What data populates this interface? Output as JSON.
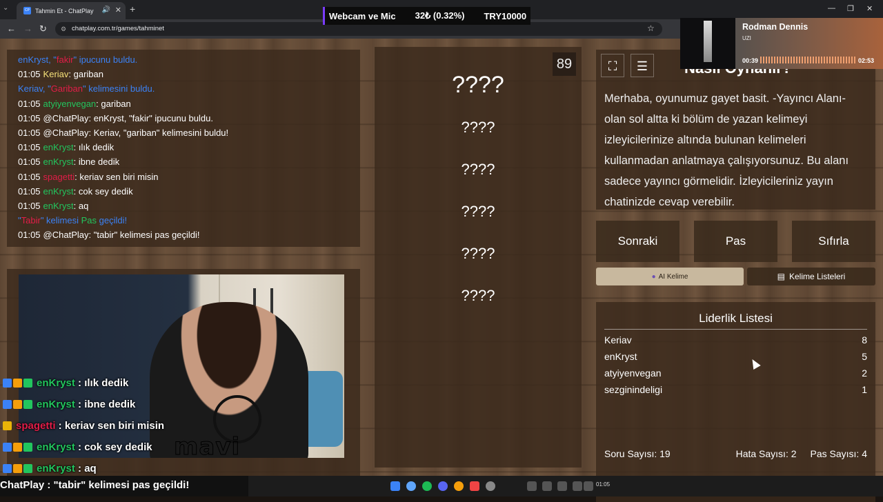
{
  "browser": {
    "tab_title": "Tahmin Et - ChatPlay",
    "tab_favicon": "CP",
    "url": "chatplay.com.tr/games/tahminet"
  },
  "stream_header": {
    "source": "Webcam ve Mic",
    "price": "32₺ (0.32%)",
    "goal": "TRY10000"
  },
  "media_widget": {
    "title": "Rodman Dennis",
    "artist": "UZI",
    "elapsed": "00:39",
    "duration": "02:53"
  },
  "chat_log": [
    {
      "time": "",
      "parts": [
        {
          "t": "enKryst, \"",
          "c": "blue"
        },
        {
          "t": "fakir",
          "c": "red"
        },
        {
          "t": "\" ipucunu buldu.",
          "c": "blue"
        }
      ]
    },
    {
      "time": "01:05",
      "parts": [
        {
          "t": "Keriav",
          "c": "yellow"
        },
        {
          "t": ": gariban",
          "c": "white"
        }
      ]
    },
    {
      "time": "",
      "parts": [
        {
          "t": "Keriav, \"",
          "c": "blue"
        },
        {
          "t": "Gariban",
          "c": "red"
        },
        {
          "t": "\" kelimesini buldu.",
          "c": "blue"
        }
      ]
    },
    {
      "time": "01:05",
      "parts": [
        {
          "t": "atyiyenvegan",
          "c": "green"
        },
        {
          "t": ": gariban",
          "c": "white"
        }
      ]
    },
    {
      "time": "01:05",
      "parts": [
        {
          "t": "@ChatPlay: enKryst, \"fakir\" ipucunu buldu.",
          "c": "white"
        }
      ]
    },
    {
      "time": "01:05",
      "parts": [
        {
          "t": "@ChatPlay: Keriav, \"gariban\" kelimesini buldu!",
          "c": "white"
        }
      ]
    },
    {
      "time": "01:05",
      "parts": [
        {
          "t": "enKryst",
          "c": "green"
        },
        {
          "t": ": ılık dedik",
          "c": "white"
        }
      ]
    },
    {
      "time": "01:05",
      "parts": [
        {
          "t": "enKryst",
          "c": "green"
        },
        {
          "t": ": ibne dedik",
          "c": "white"
        }
      ]
    },
    {
      "time": "01:05",
      "parts": [
        {
          "t": "spagetti",
          "c": "red"
        },
        {
          "t": ": keriav sen biri misin",
          "c": "white"
        }
      ]
    },
    {
      "time": "01:05",
      "parts": [
        {
          "t": "enKryst",
          "c": "green"
        },
        {
          "t": ": cok sey dedik",
          "c": "white"
        }
      ]
    },
    {
      "time": "01:05",
      "parts": [
        {
          "t": "enKryst",
          "c": "green"
        },
        {
          "t": ": aq",
          "c": "white"
        }
      ]
    },
    {
      "time": "",
      "parts": [
        {
          "t": "\"",
          "c": "blue"
        },
        {
          "t": "Tabir",
          "c": "red"
        },
        {
          "t": "\" kelimesi ",
          "c": "blue"
        },
        {
          "t": "Pas",
          "c": "green"
        },
        {
          "t": " geçildi!",
          "c": "blue"
        }
      ]
    },
    {
      "time": "01:05",
      "parts": [
        {
          "t": "@ChatPlay: \"tabir\" kelimesi pas geçildi!",
          "c": "white"
        }
      ]
    }
  ],
  "overlay_chat": [
    {
      "name": "enKryst",
      "msg": " : ılık dedik",
      "color": "green",
      "badges": true
    },
    {
      "name": "enKryst",
      "msg": " : ibne dedik",
      "color": "green",
      "badges": true
    },
    {
      "name": "spagetti",
      "msg": " : keriav sen biri misin",
      "color": "red",
      "badges": false
    },
    {
      "name": "enKryst",
      "msg": " : cok sey dedik",
      "color": "green",
      "badges": true
    },
    {
      "name": "enKryst",
      "msg": " : aq",
      "color": "green",
      "badges": true
    }
  ],
  "ticker": "ChatPlay : \"tabir\" kelimesi pas geçildi!",
  "webcam_text": "mavi",
  "board": {
    "main_word": "????",
    "hints": [
      "????",
      "????",
      "????",
      "????",
      "????"
    ],
    "timer": "89"
  },
  "howto": {
    "title": "Nasıl Oynanır?",
    "text": "Merhaba, oyunumuz gayet basit. -Yayıncı Alanı- olan sol altta ki bölüm de yazan kelimeyi izleyicilerinize altında bulunan kelimeleri kullanmadan anlatmaya çalışıyorsunuz. Bu alanı sadece yayıncı görmelidir. İzleyicileriniz yayın chatinizde cevap verebilir."
  },
  "controls": {
    "next": "Sonraki",
    "pass": "Pas",
    "reset": "Sıfırla",
    "ai_word": "AI Kelime",
    "word_lists": "Kelime Listeleri"
  },
  "leaderboard": {
    "title": "Liderlik Listesi",
    "rows": [
      {
        "name": "Keriav",
        "score": "8"
      },
      {
        "name": "enKryst",
        "score": "5"
      },
      {
        "name": "atyiyenvegan",
        "score": "2"
      },
      {
        "name": "sezginindeligi",
        "score": "1"
      }
    ],
    "question_count": "Soru Sayısı: 19",
    "error_count": "Hata Sayısı: 2",
    "pass_count": "Pas Sayısı: 4"
  },
  "taskbar": {
    "time": "01:05"
  },
  "colors": {
    "green": "#22c55e",
    "red": "#e11d48",
    "blue": "#3b82f6",
    "yellow": "#f6e27a",
    "white": "#ffffff"
  }
}
